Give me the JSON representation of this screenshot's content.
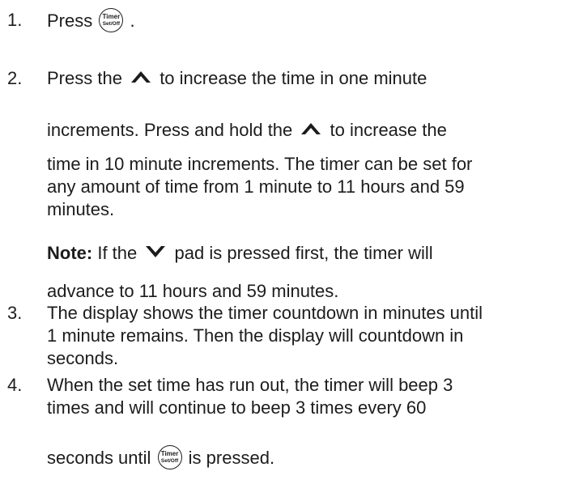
{
  "step1": {
    "number": "1.",
    "text": "Press",
    "after": ".",
    "button": {
      "top": "Timer",
      "bottom": "Set/Off"
    }
  },
  "step2": {
    "number": "2.",
    "l1_a": "Press the",
    "l1_b": "to increase the time in one minute",
    "l2_a": "increments. Press and hold the",
    "l2_b": "to increase the",
    "l3": "time in 10 minute increments. The timer can be set for",
    "l4": "any amount of time from 1 minute to 11 hours and 59",
    "l5": "minutes.",
    "note_label": "Note:",
    "note_a": "If the",
    "note_b": "pad is pressed first, the timer will",
    "note_l2": "advance to 11 hours and 59 minutes."
  },
  "step3": {
    "number": "3.",
    "l1": "The display shows the timer countdown in minutes until",
    "l2": "1 minute remains. Then the display will countdown in",
    "l3": "seconds."
  },
  "step4": {
    "number": "4.",
    "l1": "When the set time has run out, the timer will beep 3",
    "l2": "times and will continue to beep 3 times every 60",
    "l3_a": "seconds until",
    "l3_b": "is pressed.",
    "button": {
      "top": "Timer",
      "bottom": "Set/Off"
    }
  },
  "icons": {
    "up": "up-chevron-icon",
    "down": "down-chevron-icon",
    "timer": "timer-set-off-button-icon"
  }
}
